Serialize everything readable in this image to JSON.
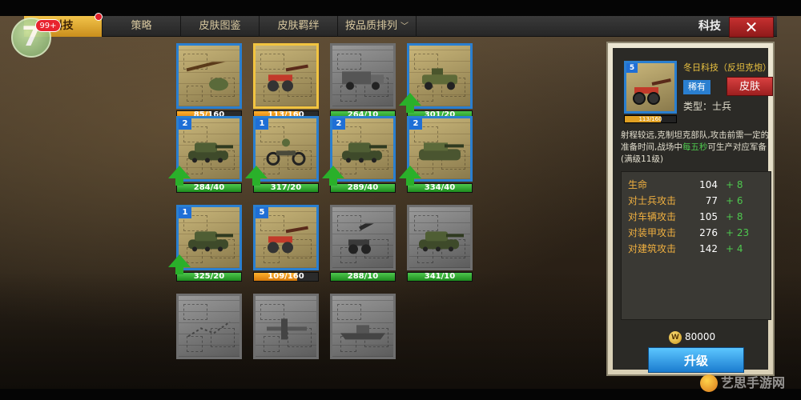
{
  "header": {
    "tabs": [
      {
        "label": "科技"
      },
      {
        "label": "策略"
      },
      {
        "label": "皮肤图鉴"
      },
      {
        "label": "皮肤羁绊"
      },
      {
        "label": "按品质排列"
      }
    ],
    "active_tab": 0,
    "title": "科技",
    "close_label": "✕"
  },
  "assistant": {
    "glyph": "7",
    "badge": "99+"
  },
  "units": [
    {
      "level": "",
      "progress_text": "85/160",
      "progress": 0.53,
      "bar_color": "orange",
      "upgradable": false,
      "rarity": "blue",
      "icon": "rifle-helmet-icon"
    },
    {
      "level": "",
      "progress_text": "113/160",
      "progress": 0.71,
      "bar_color": "orange",
      "upgradable": false,
      "rarity": "gold",
      "icon": "artillery-gun-icon"
    },
    {
      "level": "",
      "progress_text": "264/10",
      "progress": 1,
      "bar_color": "green",
      "upgradable": false,
      "rarity": "gray",
      "icon": "truck-icon"
    },
    {
      "level": "",
      "progress_text": "301/20",
      "progress": 1,
      "bar_color": "green",
      "upgradable": true,
      "rarity": "blue",
      "icon": "jeep-icon"
    },
    {
      "level": "2",
      "progress_text": "284/40",
      "progress": 1,
      "bar_color": "green",
      "upgradable": true,
      "rarity": "blue",
      "icon": "tank-icon"
    },
    {
      "level": "1",
      "progress_text": "317/20",
      "progress": 1,
      "bar_color": "green",
      "upgradable": true,
      "rarity": "blue",
      "icon": "motorcycle-icon"
    },
    {
      "level": "2",
      "progress_text": "289/40",
      "progress": 1,
      "bar_color": "green",
      "upgradable": true,
      "rarity": "blue",
      "icon": "tank-icon"
    },
    {
      "level": "2",
      "progress_text": "334/40",
      "progress": 1,
      "bar_color": "green",
      "upgradable": true,
      "rarity": "blue",
      "icon": "tank-destroyer-icon"
    },
    {
      "level": "1",
      "progress_text": "325/20",
      "progress": 1,
      "bar_color": "green",
      "upgradable": true,
      "rarity": "blue",
      "icon": "tank-icon"
    },
    {
      "level": "5",
      "progress_text": "109/160",
      "progress": 0.68,
      "bar_color": "orange",
      "upgradable": false,
      "rarity": "blue",
      "icon": "artillery-gun-icon"
    },
    {
      "level": "",
      "progress_text": "288/10",
      "progress": 1,
      "bar_color": "green",
      "upgradable": false,
      "rarity": "gray",
      "icon": "howitzer-icon"
    },
    {
      "level": "",
      "progress_text": "341/10",
      "progress": 1,
      "bar_color": "green",
      "upgradable": false,
      "rarity": "gray",
      "icon": "tank-icon"
    },
    {
      "level": "",
      "progress_text": "",
      "progress": 0,
      "bar_color": "green",
      "upgradable": false,
      "rarity": "gray",
      "icon": "map-icon"
    },
    {
      "level": "",
      "progress_text": "",
      "progress": 0,
      "bar_color": "green",
      "upgradable": false,
      "rarity": "gray",
      "icon": "plane-icon"
    },
    {
      "level": "",
      "progress_text": "",
      "progress": 0,
      "bar_color": "green",
      "upgradable": false,
      "rarity": "gray",
      "icon": "ship-icon"
    }
  ],
  "detail": {
    "level": "5",
    "progress_text": "113/160",
    "progress": 0.71,
    "name": "冬日科技（反坦克炮）",
    "rarity": "稀有",
    "skin_label": "皮肤",
    "type_label": "类型：士兵",
    "desc_before": "射程较远,克制坦克部队,攻击前需一定的准备时间,战场中",
    "desc_highlight": "每五秒",
    "desc_after": "可生产对应军备(满级11级)",
    "stats": [
      {
        "label": "生命",
        "value": "104",
        "bonus": "+ 8"
      },
      {
        "label": "对士兵攻击",
        "value": "77",
        "bonus": "+ 6"
      },
      {
        "label": "对车辆攻击",
        "value": "105",
        "bonus": "+ 8"
      },
      {
        "label": "对装甲攻击",
        "value": "276",
        "bonus": "+ 23"
      },
      {
        "label": "对建筑攻击",
        "value": "142",
        "bonus": "+ 4"
      }
    ],
    "cost": "80000",
    "coin_glyph": "W",
    "upgrade_label": "升级"
  },
  "watermark": "艺思手游网",
  "colors": {
    "accent_gold": "#f2c34a",
    "rare_blue": "#2a7fd0",
    "upgrade_green": "#2ab02a",
    "danger_red": "#c63030"
  }
}
